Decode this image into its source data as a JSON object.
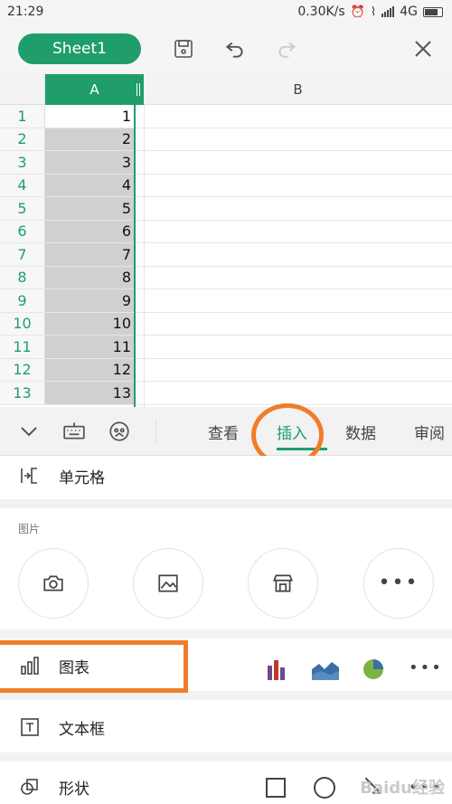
{
  "status_bar": {
    "time": "21:29",
    "speed": "0.30K/s",
    "network": "4G",
    "icons": [
      "alarm-icon",
      "vibrate-icon",
      "signal-icon",
      "battery-icon"
    ]
  },
  "toolbar": {
    "sheet_name": "Sheet1",
    "icons": [
      "save-icon",
      "undo-icon",
      "redo-icon",
      "close-icon"
    ]
  },
  "grid": {
    "columns": [
      "A",
      "B"
    ],
    "rows": [
      {
        "num": "1",
        "a": "1"
      },
      {
        "num": "2",
        "a": "2"
      },
      {
        "num": "3",
        "a": "3"
      },
      {
        "num": "4",
        "a": "4"
      },
      {
        "num": "5",
        "a": "5"
      },
      {
        "num": "6",
        "a": "6"
      },
      {
        "num": "7",
        "a": "7"
      },
      {
        "num": "8",
        "a": "8"
      },
      {
        "num": "9",
        "a": "9"
      },
      {
        "num": "10",
        "a": "10"
      },
      {
        "num": "11",
        "a": "11"
      },
      {
        "num": "12",
        "a": "12"
      },
      {
        "num": "13",
        "a": "13"
      }
    ]
  },
  "ribbon": {
    "tabs": [
      {
        "label": "查看",
        "active": false
      },
      {
        "label": "插入",
        "active": true
      },
      {
        "label": "数据",
        "active": false
      },
      {
        "label": "审阅",
        "active": false
      }
    ],
    "accent": "#1f9e6b",
    "highlight": "#f07d2a"
  },
  "panel": {
    "cell_item": "单元格",
    "picture_title": "图片",
    "picture_icons": [
      "camera-icon",
      "image-icon",
      "store-icon",
      "more-icon"
    ],
    "chart_item": "图表",
    "chart_icons": [
      "bar-chart-icon",
      "area-chart-icon",
      "pie-chart-icon",
      "more-icon"
    ],
    "textbox_item": "文本框",
    "shape_item": "形状",
    "shape_icons": [
      "square-icon",
      "circle-icon",
      "arrow-icon",
      "more-icon"
    ],
    "watermark": "Baidu经验"
  }
}
